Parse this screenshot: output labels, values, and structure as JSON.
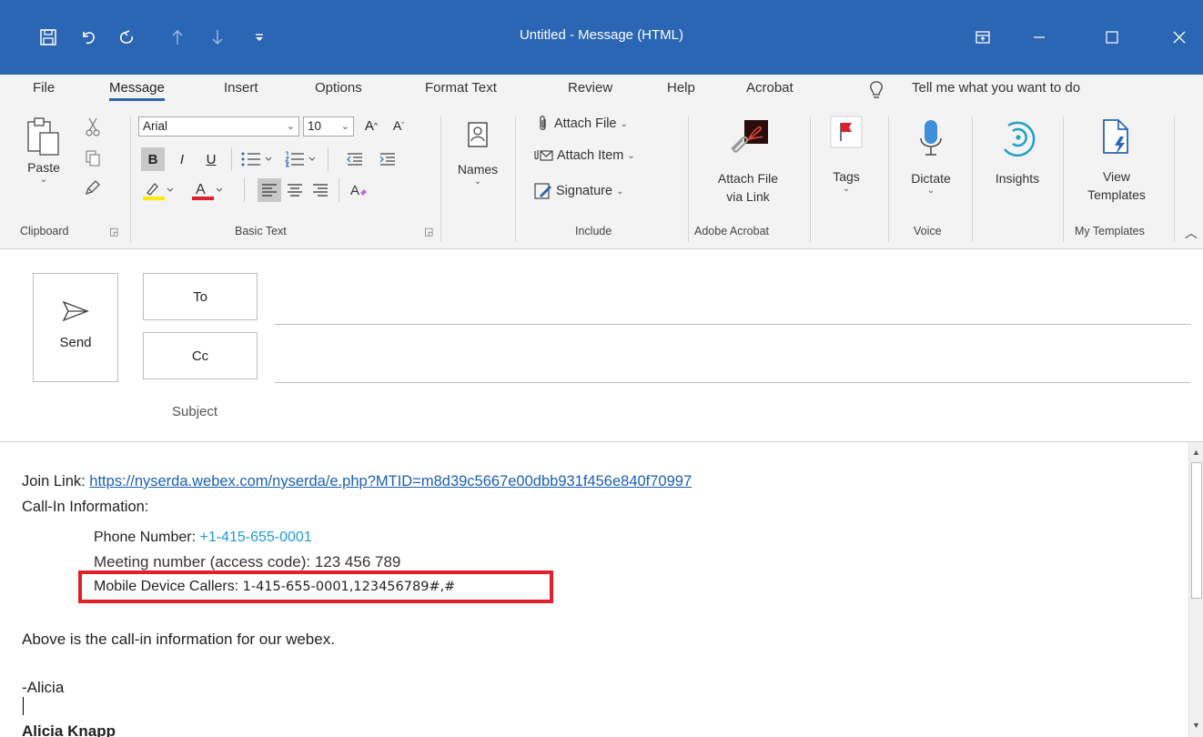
{
  "window": {
    "title": "Untitled  -  Message (HTML)",
    "accent": "#2b66b5",
    "qa_icons": [
      "save-icon",
      "undo-icon",
      "redo-icon",
      "up-arrow-icon",
      "down-arrow-icon",
      "customize-dropdown-icon"
    ],
    "controls": [
      "ribbon-display-icon",
      "minimize-icon",
      "maximize-icon",
      "close-icon"
    ]
  },
  "tabs": [
    {
      "label": "File"
    },
    {
      "label": "Message"
    },
    {
      "label": "Insert"
    },
    {
      "label": "Options"
    },
    {
      "label": "Format Text"
    },
    {
      "label": "Review"
    },
    {
      "label": "Help"
    },
    {
      "label": "Acrobat"
    }
  ],
  "tell_me": "Tell me what you want to do",
  "ribbon": {
    "clipboard": {
      "paste": "Paste",
      "group": "Clipboard"
    },
    "basic_text": {
      "font": "Arial",
      "size": "10",
      "bold": "B",
      "italic": "I",
      "underline": "U",
      "group": "Basic Text"
    },
    "names": {
      "label": "Names"
    },
    "include": {
      "attach_file": "Attach File",
      "attach_item": "Attach Item",
      "signature": "Signature",
      "group": "Include"
    },
    "acrobat": {
      "line1": "Attach File",
      "line2": "via Link",
      "group": "Adobe Acrobat"
    },
    "tags": {
      "label": "Tags"
    },
    "voice": {
      "dictate": "Dictate",
      "group": "Voice"
    },
    "insights": {
      "label": "Insights"
    },
    "templates": {
      "line1": "View",
      "line2": "Templates",
      "group": "My Templates"
    }
  },
  "compose": {
    "send": "Send",
    "to": "To",
    "cc": "Cc",
    "subject": "Subject"
  },
  "body": {
    "join_label": "Join Link: ",
    "join_url": "https://nyserda.webex.com/nyserda/e.php?MTID=m8d39c5667e00dbb931f456e840f70997",
    "callin": "Call-In Information:",
    "phone_label": "Phone Number: ",
    "phone_value": "+1-415-655-0001",
    "meeting": "Meeting number (access code): 123 456 789",
    "mobile_label": "Mobile Device Callers: ",
    "mobile_value": "1-415-655-0001,123456789#,#",
    "above": "Above is the call-in information for our webex.",
    "sign": "-Alicia",
    "name": "Alicia Knapp",
    "highlight_color": "#e0202a"
  }
}
